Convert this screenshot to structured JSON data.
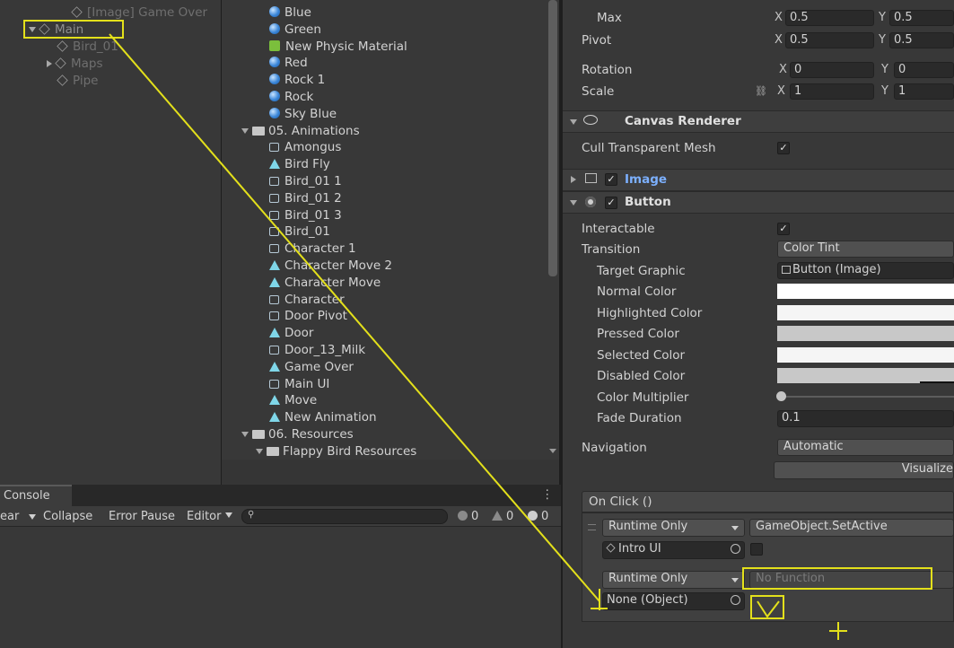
{
  "colors": {
    "annotation": "#e3e01b",
    "accent": "#5aa6ff",
    "panel": "#383838"
  },
  "hierarchy": {
    "items": [
      {
        "label": "[Image] Game Over",
        "icon": "cube-icon",
        "state": "dim"
      },
      {
        "label": "Main",
        "icon": "cube-icon",
        "state": "expanded"
      },
      {
        "label": "Bird_01",
        "icon": "cube-icon",
        "state": "dim"
      },
      {
        "label": "Maps",
        "icon": "cube-icon",
        "state": "collapsed"
      },
      {
        "label": "Pipe",
        "icon": "cube-icon",
        "state": "dim"
      }
    ]
  },
  "project": {
    "items": [
      {
        "label": "Blue",
        "icon": "material-icon"
      },
      {
        "label": "Green",
        "icon": "material-icon"
      },
      {
        "label": "New Physic Material",
        "icon": "physic-material-icon"
      },
      {
        "label": "Red",
        "icon": "material-icon"
      },
      {
        "label": "Rock 1",
        "icon": "material-icon"
      },
      {
        "label": "Rock",
        "icon": "material-icon"
      },
      {
        "label": "Sky Blue",
        "icon": "material-icon"
      },
      {
        "label": "05. Animations",
        "icon": "folder-icon"
      },
      {
        "label": "Amongus",
        "icon": "animator-controller-icon"
      },
      {
        "label": "Bird Fly",
        "icon": "animation-clip-icon"
      },
      {
        "label": "Bird_01 1",
        "icon": "animator-controller-icon"
      },
      {
        "label": "Bird_01 2",
        "icon": "animator-controller-icon"
      },
      {
        "label": "Bird_01 3",
        "icon": "animator-controller-icon"
      },
      {
        "label": "Bird_01",
        "icon": "animator-controller-icon"
      },
      {
        "label": "Character 1",
        "icon": "animator-controller-icon"
      },
      {
        "label": "Character Move 2",
        "icon": "animation-clip-icon"
      },
      {
        "label": "Character Move",
        "icon": "animation-clip-icon"
      },
      {
        "label": "Character",
        "icon": "animator-controller-icon"
      },
      {
        "label": "Door Pivot",
        "icon": "animator-controller-icon"
      },
      {
        "label": "Door",
        "icon": "animation-clip-icon"
      },
      {
        "label": "Door_13_Milk",
        "icon": "animator-controller-icon"
      },
      {
        "label": "Game Over",
        "icon": "animation-clip-icon"
      },
      {
        "label": "Main UI",
        "icon": "animator-controller-icon"
      },
      {
        "label": "Move",
        "icon": "animation-clip-icon"
      },
      {
        "label": "New Animation",
        "icon": "animation-clip-icon"
      },
      {
        "label": "06. Resources",
        "icon": "folder-icon"
      },
      {
        "label": "Flappy Bird Resources",
        "icon": "folder-icon"
      }
    ]
  },
  "console": {
    "tab": "Console",
    "toolbar": {
      "clear": "ear",
      "collapse": "Collapse",
      "error_pause": "Error Pause",
      "editor": "Editor",
      "search_placeholder": ""
    },
    "counts": {
      "errors": "0",
      "warnings": "0",
      "logs": "0"
    }
  },
  "inspector": {
    "rect": {
      "max_label": "Max",
      "max_x": "0.5",
      "max_y": "0.5",
      "pivot_label": "Pivot",
      "pivot_x": "0.5",
      "pivot_y": "0.5",
      "rotation_label": "Rotation",
      "rotation_x": "0",
      "rotation_y": "0",
      "scale_label": "Scale",
      "scale_x": "1",
      "scale_y": "1",
      "axis_x": "X",
      "axis_y": "Y"
    },
    "canvas_renderer": {
      "title": "Canvas Renderer",
      "cull_label": "Cull Transparent Mesh",
      "cull_checked": true
    },
    "image": {
      "title": "Image",
      "enabled": true
    },
    "button": {
      "title": "Button",
      "enabled": true,
      "interactable_label": "Interactable",
      "interactable_checked": true,
      "transition_label": "Transition",
      "transition_value": "Color Tint",
      "target_graphic_label": "Target Graphic",
      "target_graphic_value": "Button (Image)",
      "normal_color_label": "Normal Color",
      "highlighted_color_label": "Highlighted Color",
      "pressed_color_label": "Pressed Color",
      "selected_color_label": "Selected Color",
      "disabled_color_label": "Disabled Color",
      "color_multiplier_label": "Color Multiplier",
      "fade_duration_label": "Fade Duration",
      "fade_duration_value": "0.1",
      "navigation_label": "Navigation",
      "navigation_value": "Automatic",
      "visualize_label": "Visualize"
    },
    "on_click": {
      "title": "On Click ()",
      "entries": [
        {
          "mode": "Runtime Only",
          "function": "GameObject.SetActive",
          "object": "Intro UI"
        },
        {
          "mode": "Runtime Only",
          "function": "No Function",
          "object": "None (Object)"
        }
      ]
    }
  }
}
